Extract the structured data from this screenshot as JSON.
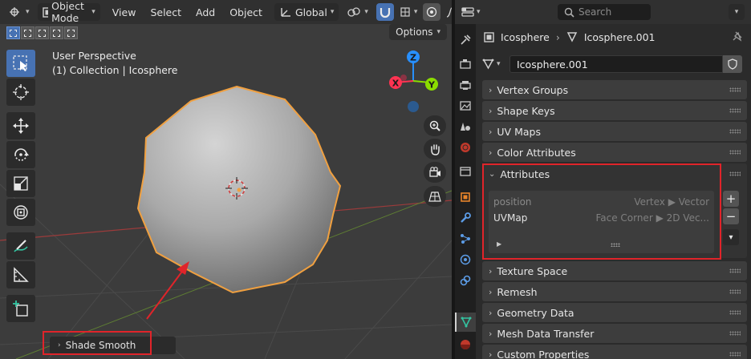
{
  "viewport": {
    "header": {
      "mode_label": "Object Mode",
      "menu": [
        "View",
        "Select",
        "Add",
        "Object"
      ],
      "orientation_label": "Global"
    },
    "options_label": "Options",
    "info": {
      "line1": "User Perspective",
      "line2": "(1) Collection | Icosphere"
    },
    "gizmo": {
      "z": "Z",
      "y": "Y",
      "x": "X"
    },
    "last_operator": "Shade Smooth",
    "colors": {
      "background": "#3c3c3c",
      "selection_outline": "#f0a040",
      "highlight_box": "#e0242a",
      "x_axis": "#ff3352",
      "y_axis": "#8bdc00",
      "z_axis": "#2890ff"
    }
  },
  "properties": {
    "search_placeholder": "Search",
    "breadcrumb": {
      "object": "Icosphere",
      "mesh": "Icosphere.001"
    },
    "datablock_name": "Icosphere.001",
    "panels_above": [
      "Vertex Groups",
      "Shape Keys",
      "UV Maps",
      "Color Attributes"
    ],
    "attributes": {
      "title": "Attributes",
      "rows": [
        {
          "name": "position",
          "domain": "Vertex ▶ Vector"
        },
        {
          "name": "UVMap",
          "domain": "Face Corner ▶ 2D Vec..."
        }
      ],
      "add_label": "+",
      "remove_label": "−"
    },
    "panels_below": [
      "Texture Space",
      "Remesh",
      "Geometry Data",
      "Mesh Data Transfer",
      "Custom Properties"
    ],
    "tabs": [
      "tool",
      "render",
      "output",
      "view-layer",
      "scene",
      "world",
      "collection",
      "object",
      "modifiers",
      "particles",
      "physics",
      "constraints",
      "data",
      "material"
    ]
  }
}
